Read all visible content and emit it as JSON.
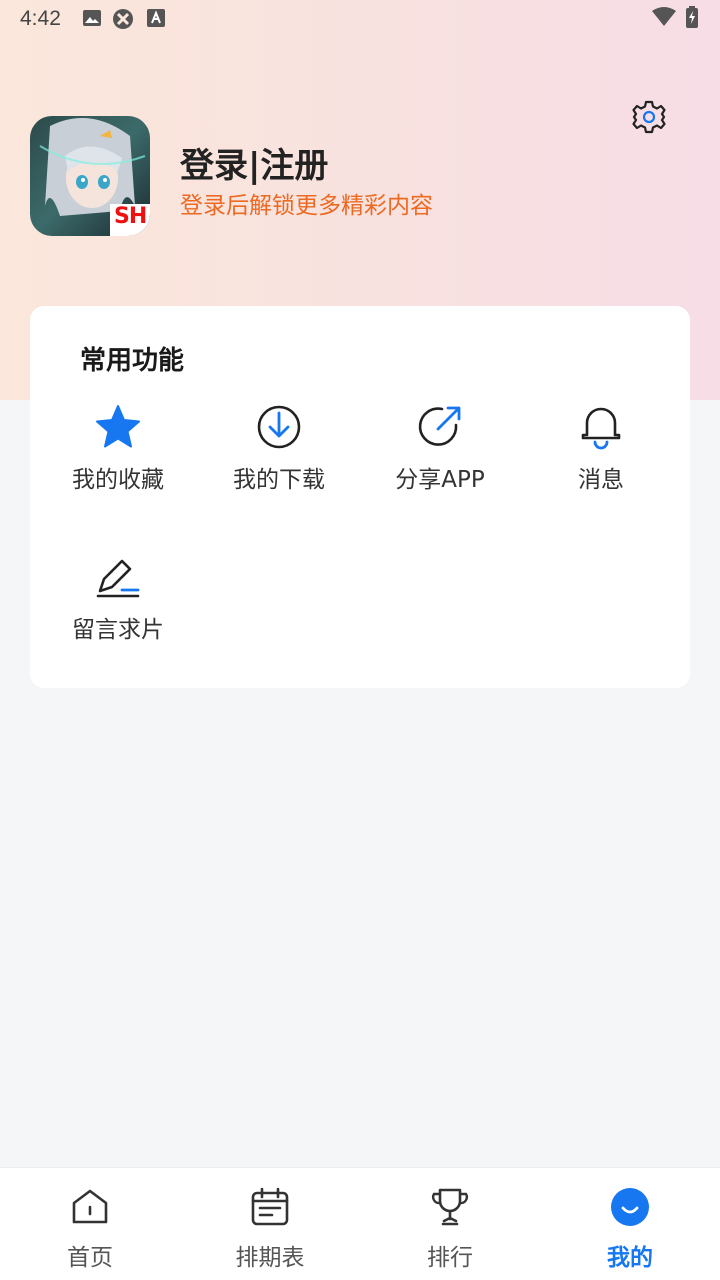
{
  "status_bar": {
    "time": "4:42"
  },
  "profile": {
    "login_label": "登录|注册",
    "subtitle": "登录后解锁更多精彩内容",
    "avatar_badge": "SH"
  },
  "functions_card": {
    "title": "常用功能",
    "items": [
      {
        "label": "我的收藏",
        "icon": "star-icon"
      },
      {
        "label": "我的下载",
        "icon": "download-icon"
      },
      {
        "label": "分享APP",
        "icon": "share-icon"
      },
      {
        "label": "消息",
        "icon": "bell-icon"
      },
      {
        "label": "留言求片",
        "icon": "edit-icon"
      }
    ]
  },
  "tabbar": {
    "items": [
      {
        "label": "首页",
        "icon": "home-icon"
      },
      {
        "label": "排期表",
        "icon": "calendar-icon"
      },
      {
        "label": "排行",
        "icon": "trophy-icon"
      },
      {
        "label": "我的",
        "icon": "profile-icon",
        "active": true
      }
    ]
  },
  "colors": {
    "accent": "#1677f0",
    "subtitle": "#ec6a22",
    "card_bg": "#ffffff",
    "page_bg": "#f5f6f8"
  }
}
